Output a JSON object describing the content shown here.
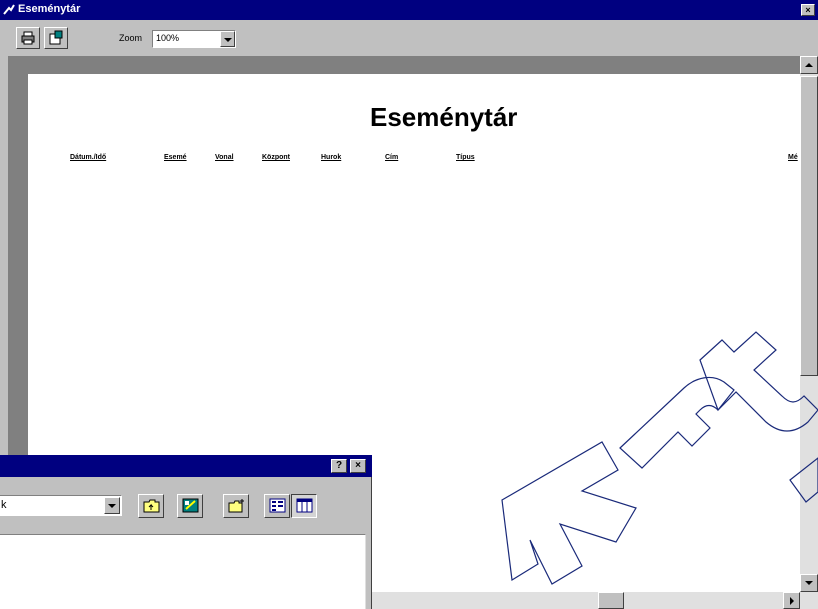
{
  "window": {
    "title": "Eseménytár",
    "close_glyph": "×"
  },
  "toolbar": {
    "icons": [
      "print-icon",
      "export-icon"
    ],
    "zoom_label": "Zoom",
    "zoom_value": "100%"
  },
  "report": {
    "title": "Eseménytár",
    "columns": [
      "Dátum./Idő",
      "Esemé",
      "Vonal",
      "Központ",
      "Hurok",
      "Cím",
      "Típus",
      "Mé"
    ]
  },
  "dialog": {
    "help_glyph": "?",
    "close_glyph": "×",
    "combo_value": "k",
    "icons": [
      "up-folder-icon",
      "desktop-icon",
      "new-folder-icon",
      "list-view-icon",
      "details-view-icon"
    ]
  },
  "watermark": {
    "text": "kft"
  },
  "colors": {
    "titlebar": "#000080",
    "face": "#c0c0c0",
    "page": "#ffffff",
    "watermark": "#1a2a7a"
  }
}
